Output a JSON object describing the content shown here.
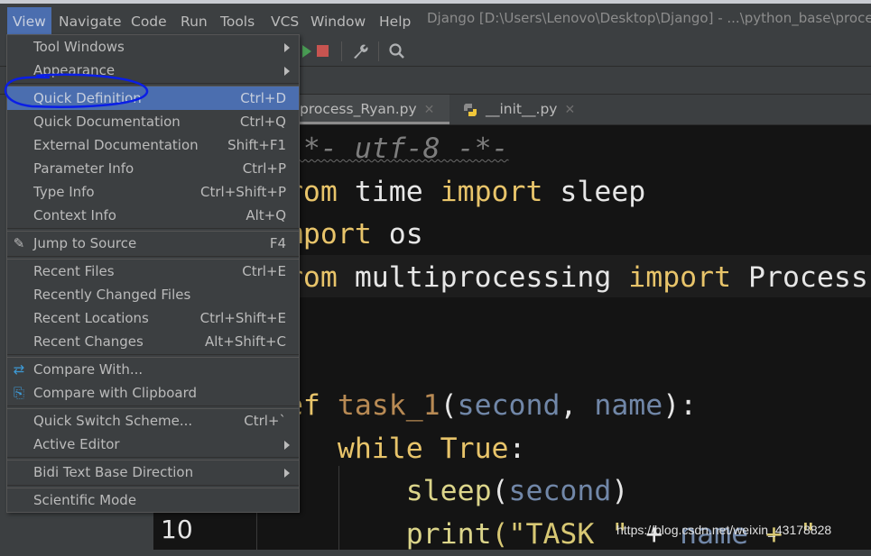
{
  "menubar": {
    "items": [
      "View",
      "Navigate",
      "Code",
      "Run",
      "Tools",
      "VCS",
      "Window",
      "Help"
    ],
    "active": "View"
  },
  "window_title": "Django [D:\\Users\\Lenovo\\Desktop\\Django] - ...\\python_base\\proces",
  "toolbar": {
    "icons": [
      "run-icon",
      "stop-icon",
      "wrench-icon",
      "search-icon"
    ],
    "stop_color": "#c75450"
  },
  "tabs": [
    {
      "label": "process_Ryan.py",
      "selected": true
    },
    {
      "label": "__init__.py",
      "selected": false
    }
  ],
  "view_menu": [
    {
      "label": "Tool Windows",
      "submenu": true
    },
    {
      "label": "Appearance",
      "submenu": true
    },
    {
      "sep": true
    },
    {
      "label": "Quick Definition",
      "shortcut": "Ctrl+D",
      "highlighted": true
    },
    {
      "label": "Quick Documentation",
      "shortcut": "Ctrl+Q"
    },
    {
      "label": "External Documentation",
      "shortcut": "Shift+F1"
    },
    {
      "label": "Parameter Info",
      "shortcut": "Ctrl+P"
    },
    {
      "label": "Type Info",
      "shortcut": "Ctrl+Shift+P"
    },
    {
      "label": "Context Info",
      "shortcut": "Alt+Q"
    },
    {
      "sep": true
    },
    {
      "label": "Jump to Source",
      "shortcut": "F4",
      "icon": "pencil-icon"
    },
    {
      "sep": true
    },
    {
      "label": "Recent Files",
      "shortcut": "Ctrl+E"
    },
    {
      "label": "Recently Changed Files"
    },
    {
      "label": "Recent Locations",
      "shortcut": "Ctrl+Shift+E"
    },
    {
      "label": "Recent Changes",
      "shortcut": "Alt+Shift+C"
    },
    {
      "sep": true
    },
    {
      "label": "Compare With...",
      "icon": "compare-icon"
    },
    {
      "label": "Compare with Clipboard",
      "icon": "compare-clipboard-icon"
    },
    {
      "sep": true
    },
    {
      "label": "Quick Switch Scheme...",
      "shortcut": "Ctrl+`"
    },
    {
      "label": "Active Editor",
      "submenu": true
    },
    {
      "sep": true
    },
    {
      "label": "Bidi Text Base Direction",
      "submenu": true
    },
    {
      "sep": true
    },
    {
      "label": "Scientific Mode"
    }
  ],
  "editor": {
    "line_number": "10",
    "lines": [
      [
        {
          "t": "#-*- utf-8 -*-",
          "c": "cm"
        }
      ],
      [
        {
          "t": "from ",
          "c": "kw"
        },
        {
          "t": "time "
        },
        {
          "t": "import ",
          "c": "kw"
        },
        {
          "t": "sleep"
        }
      ],
      [
        {
          "t": "import ",
          "c": "kw"
        },
        {
          "t": "os"
        }
      ],
      [
        {
          "t": "from ",
          "c": "kw"
        },
        {
          "t": "multiprocessing "
        },
        {
          "t": "import ",
          "c": "kw"
        },
        {
          "t": "Process"
        }
      ],
      [],
      [],
      [
        {
          "t": "def ",
          "c": "kw"
        },
        {
          "t": "task_1",
          "c": "fn"
        },
        {
          "t": "("
        },
        {
          "t": "second",
          "c": "pm"
        },
        {
          "t": ", "
        },
        {
          "t": "name",
          "c": "pm"
        },
        {
          "t": "):"
        }
      ],
      [
        {
          "t": "    "
        },
        {
          "t": "while ",
          "c": "kw"
        },
        {
          "t": "True",
          "c": "kw"
        },
        {
          "t": ":"
        }
      ],
      [
        {
          "t": "        "
        },
        {
          "t": "sleep",
          "c": "call"
        },
        {
          "t": "("
        },
        {
          "t": "second",
          "c": "pm"
        },
        {
          "t": ")"
        }
      ],
      [
        {
          "t": "        "
        },
        {
          "t": "print",
          "c": "call"
        },
        {
          "t": "(\"TASK \"",
          "c": "str"
        },
        {
          "t": " + "
        },
        {
          "t": "name",
          "c": "pm"
        },
        {
          "t": " + \"",
          "c": "str"
        }
      ]
    ]
  },
  "watermark": "https://blog.csdn.net/weixin_43178828",
  "annotation_color": "#0a1ee6"
}
